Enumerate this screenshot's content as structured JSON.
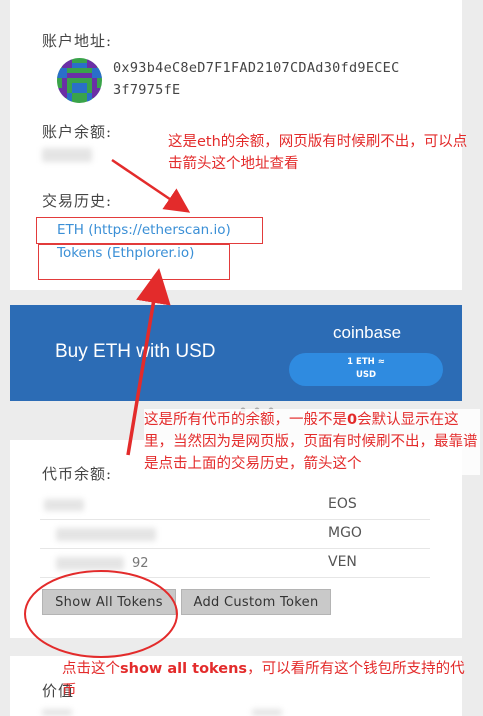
{
  "account": {
    "address_label": "账户地址:",
    "address_line1": "0x93b4eC8eD7F1FAD2107CDAd30fd9ECEC",
    "address_line2": "3f7975fE",
    "balance_label": "账户余额:",
    "history_label": "交易历史:",
    "link_eth": "ETH (https://etherscan.io)",
    "link_tokens": "Tokens (Ethplorer.io)"
  },
  "banner": {
    "title": "Buy ETH with USD",
    "brand": "coinbase",
    "rate_line1": "1 ETH ≈",
    "rate_line2": "USD",
    "bg": "#2c6cb5"
  },
  "tokens": {
    "label": "代币余额:",
    "rows": [
      {
        "symbol": "EOS"
      },
      {
        "symbol": "MGO"
      },
      {
        "symbol": "VEN"
      }
    ],
    "fragment": "92",
    "show_all_button": "Show All Tokens",
    "add_custom_button": "Add Custom Token"
  },
  "price_label": "价值",
  "annotations": {
    "note1": "这是eth的余额，网页版有时候刷不出，可以点击箭头这个地址查看",
    "note2_a": "这是所有代币的余额，一般不是",
    "note2_b": "0",
    "note2_c": "会默认显示在这里，当然因为是网页版，页面有时候刷不出，最靠谱是点击上面的交易历史，箭头这个",
    "note3_a": "点击这个",
    "note3_b": "show all tokens",
    "note3_c": "，可以看所有这个钱包所支持的代币",
    "color": "#e32b2b"
  }
}
